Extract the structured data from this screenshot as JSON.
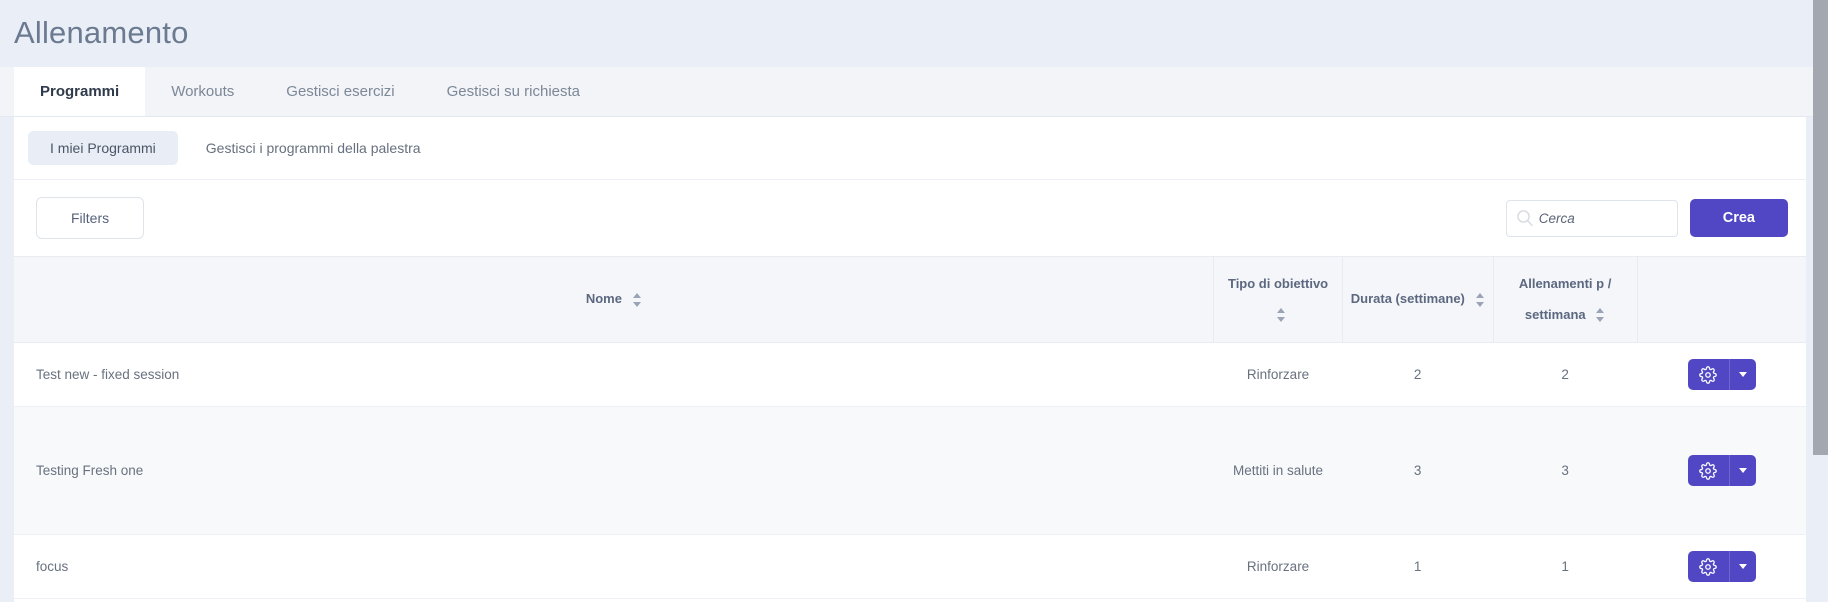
{
  "page": {
    "title": "Allenamento",
    "accent_color": "#5147c4",
    "background_color": "#eaeff7",
    "card_color": "#ffffff"
  },
  "tabs": [
    {
      "label": "Programmi",
      "active": true
    },
    {
      "label": "Workouts",
      "active": false
    },
    {
      "label": "Gestisci esercizi",
      "active": false
    },
    {
      "label": "Gestisci su richiesta",
      "active": false
    }
  ],
  "subtabs": [
    {
      "label": "I miei Programmi",
      "active": true
    },
    {
      "label": "Gestisci i programmi della palestra",
      "active": false
    }
  ],
  "toolbar": {
    "filters_label": "Filters",
    "search": {
      "placeholder": "Cerca",
      "value": "",
      "icon": "search-icon"
    },
    "create_label": "Crea"
  },
  "table": {
    "columns": [
      {
        "key": "name",
        "label": "Nome",
        "sortable": true
      },
      {
        "key": "goal",
        "label": "Tipo di obiettivo",
        "sortable": true
      },
      {
        "key": "duration",
        "label": "Durata (settimane)",
        "sortable": true
      },
      {
        "key": "per_week",
        "label": "Allenamenti p / settimana",
        "sortable": true
      },
      {
        "key": "actions",
        "label": "",
        "sortable": false
      }
    ],
    "rows": [
      {
        "name": "Test new - fixed session",
        "goal": "Rinforzare",
        "duration": "2",
        "per_week": "2",
        "action_icon": "gear-icon",
        "action_caret": "chevron-down-icon"
      },
      {
        "name": "Testing Fresh one",
        "goal": "Mettiti in salute",
        "duration": "3",
        "per_week": "3",
        "action_icon": "gear-icon",
        "action_caret": "chevron-down-icon"
      },
      {
        "name": "focus",
        "goal": "Rinforzare",
        "duration": "1",
        "per_week": "1",
        "action_icon": "gear-icon",
        "action_caret": "chevron-down-icon"
      }
    ]
  }
}
